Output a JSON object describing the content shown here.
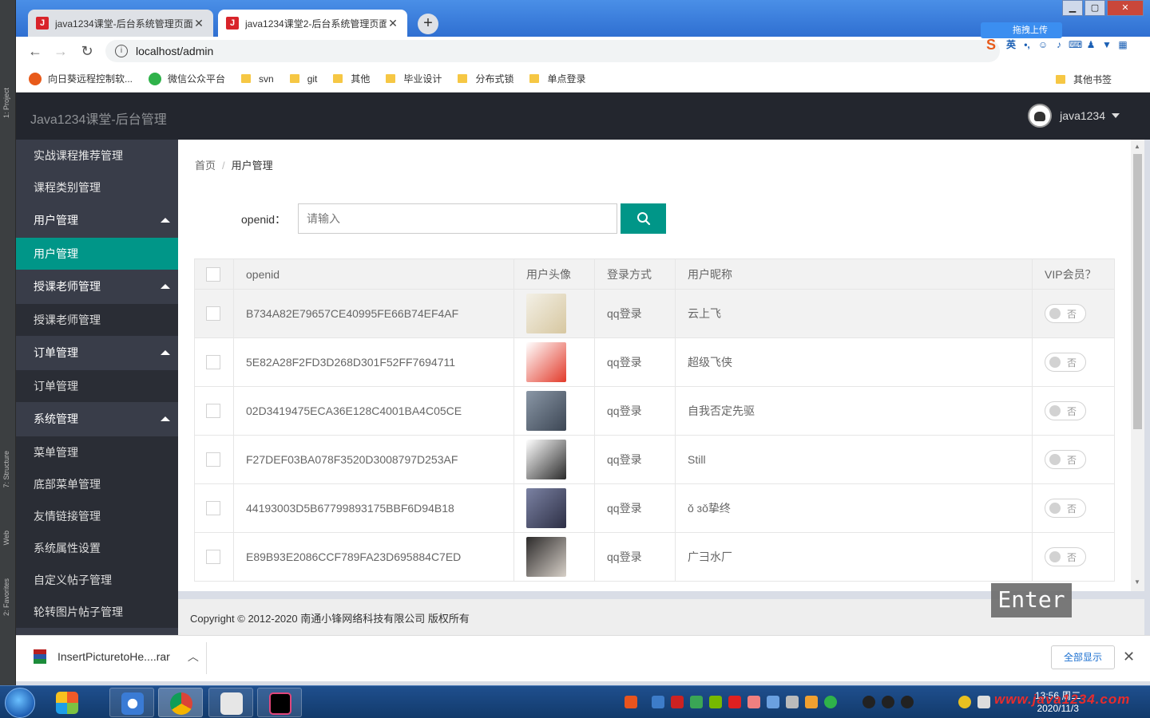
{
  "browser": {
    "tabs": [
      {
        "title": "java1234课堂-后台系统管理页面",
        "active": false
      },
      {
        "title": "java1234课堂2-后台系统管理页面",
        "active": true
      }
    ],
    "url": "localhost/admin",
    "bookmarks": [
      {
        "label": "向日葵远程控制软...",
        "icon": "sunflower-icon"
      },
      {
        "label": "微信公众平台",
        "icon": "wechat-icon"
      },
      {
        "label": "svn",
        "icon": "folder-icon"
      },
      {
        "label": "git",
        "icon": "folder-icon"
      },
      {
        "label": "其他",
        "icon": "folder-icon"
      },
      {
        "label": "毕业设计",
        "icon": "folder-icon"
      },
      {
        "label": "分布式锁",
        "icon": "folder-icon"
      },
      {
        "label": "单点登录",
        "icon": "folder-icon"
      }
    ],
    "other_bookmarks": "其他书签",
    "ime_language": "英",
    "upload_chip": "拖拽上传"
  },
  "ide": {
    "labels": [
      "1: Project",
      "7: Structure",
      "Web",
      "2: Favorites"
    ]
  },
  "app": {
    "title": "Java1234课堂-后台管理",
    "username": "java1234"
  },
  "sidebar": {
    "items": [
      {
        "label": "实战课程推荐管理",
        "kind": "link"
      },
      {
        "label": "课程类别管理",
        "kind": "link"
      },
      {
        "label": "用户管理",
        "kind": "group"
      },
      {
        "label": "用户管理",
        "kind": "active"
      },
      {
        "label": "授课老师管理",
        "kind": "group"
      },
      {
        "label": "授课老师管理",
        "kind": "sub"
      },
      {
        "label": "订单管理",
        "kind": "group"
      },
      {
        "label": "订单管理",
        "kind": "sub"
      },
      {
        "label": "系统管理",
        "kind": "group"
      },
      {
        "label": "菜单管理",
        "kind": "sub"
      },
      {
        "label": "底部菜单管理",
        "kind": "sub"
      },
      {
        "label": "友情链接管理",
        "kind": "sub"
      },
      {
        "label": "系统属性设置",
        "kind": "sub"
      },
      {
        "label": "自定义帖子管理",
        "kind": "sub"
      },
      {
        "label": "轮转图片帖子管理",
        "kind": "sub"
      }
    ]
  },
  "breadcrumb": {
    "home": "首页",
    "separator": "/",
    "current": "用户管理"
  },
  "search": {
    "label": "openid：",
    "placeholder": "请输入",
    "value": ""
  },
  "table": {
    "columns": [
      "openid",
      "用户头像",
      "登录方式",
      "用户昵称",
      "VIP会员？"
    ],
    "rows": [
      {
        "openid": "B734A82E79657CE40995FE66B74EF4AF",
        "login": "qq登录",
        "nickname": "云上飞",
        "vip": "否",
        "avatar_colors": [
          "#f3f0e6",
          "#d7c7a0"
        ]
      },
      {
        "openid": "5E82A28F2FD3D268D301F52FF7694711",
        "login": "qq登录",
        "nickname": "超级飞侠",
        "vip": "否",
        "avatar_colors": [
          "#ffffff",
          "#e23a2a"
        ]
      },
      {
        "openid": "02D3419475ECA36E128C4001BA4C05CE",
        "login": "qq登录",
        "nickname": "自我否定先驱",
        "vip": "否",
        "avatar_colors": [
          "#8a97a6",
          "#3c4654"
        ]
      },
      {
        "openid": "F27DEF03BA078F3520D3008797D253AF",
        "login": "qq登录",
        "nickname": "Still",
        "vip": "否",
        "avatar_colors": [
          "#ffffff",
          "#2a2a2a"
        ]
      },
      {
        "openid": "44193003D5B67799893175BBF6D94B18",
        "login": "qq登录",
        "nickname": "ǒ ɜǒ挚终",
        "vip": "否",
        "avatar_colors": [
          "#7b82a3",
          "#2d2f45"
        ]
      },
      {
        "openid": "E89B93E2086CCF789FA23D695884C7ED",
        "login": "qq登录",
        "nickname": "广彐水厂",
        "vip": "否",
        "avatar_colors": [
          "#2c2a2a",
          "#d7d0c8"
        ]
      }
    ]
  },
  "footer": {
    "text": "Copyright © 2012-2020 南通小锋网络科技有限公司 版权所有"
  },
  "overlay": {
    "key": "Enter"
  },
  "download": {
    "filename": "InsertPicturetoHe....rar",
    "show_all": "全部显示"
  },
  "taskbar": {
    "time": "13:56 周二",
    "date": "2020/11/3"
  },
  "watermark": "www.java1234.com",
  "colors": {
    "accent": "#009688",
    "sidebar": "#393d49",
    "header": "#23262e"
  }
}
